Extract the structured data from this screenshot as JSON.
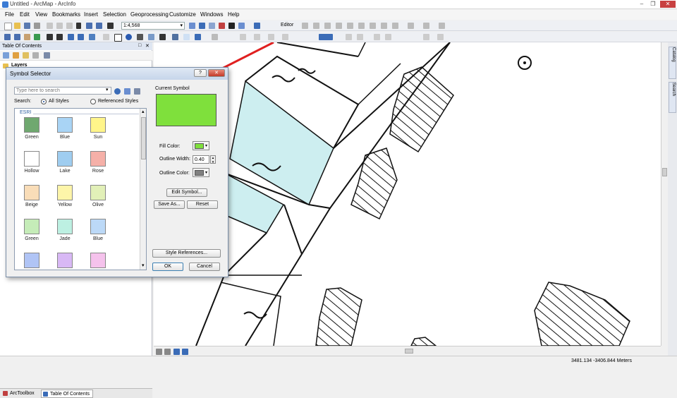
{
  "window": {
    "title": "Untitled - ArcMap - ArcInfo"
  },
  "menu": [
    "File",
    "Edit",
    "View",
    "Bookmarks",
    "Insert",
    "Selection",
    "Geoprocessing",
    "Customize",
    "Windows",
    "Help"
  ],
  "toolbar": {
    "scale": "1:4,568",
    "editor_label": "Editor"
  },
  "toc": {
    "title": "Table Of Contents",
    "layers_label": "Layers"
  },
  "bottom_tabs": [
    "ArcToolbox",
    "Table Of Contents"
  ],
  "right_dock": [
    "Catalog",
    "Search"
  ],
  "status": {
    "coordinates": "3481.134  -3406.844 Meters"
  },
  "dialog": {
    "title": "Symbol Selector",
    "search_placeholder": "Type here to search",
    "search_label": "Search:",
    "all_styles": "All Styles",
    "referenced_styles": "Referenced Styles",
    "group": "ESRI",
    "current_symbol_label": "Current Symbol",
    "current_symbol_color": "#7fe03c",
    "fill_color_label": "Fill Color:",
    "fill_color": "#7fe03c",
    "outline_width_label": "Outline Width:",
    "outline_width": "0.40",
    "outline_color_label": "Outline Color:",
    "outline_color": "#808080",
    "edit_symbol": "Edit Symbol...",
    "save_as": "Save As...",
    "reset": "Reset",
    "style_references": "Style References...",
    "ok": "OK",
    "cancel": "Cancel",
    "swatches": [
      {
        "name": "Green",
        "color": "#6fa86f"
      },
      {
        "name": "Blue",
        "color": "#a9d4f5"
      },
      {
        "name": "Sun",
        "color": "#fff58a"
      },
      {
        "name": "Hollow",
        "color": "#ffffff"
      },
      {
        "name": "Lake",
        "color": "#9fcdf0"
      },
      {
        "name": "Rose",
        "color": "#f5b0a8"
      },
      {
        "name": "Beige",
        "color": "#f9ddb8"
      },
      {
        "name": "Yellow",
        "color": "#fdf5a9"
      },
      {
        "name": "Olive",
        "color": "#e2f0b8"
      },
      {
        "name": "Green",
        "color": "#c5ecb8"
      },
      {
        "name": "Jade",
        "color": "#bdf0e2"
      },
      {
        "name": "Blue",
        "color": "#bcd9f7"
      },
      {
        "name": "",
        "color": "#b0c4f5"
      },
      {
        "name": "",
        "color": "#d8b8f5"
      },
      {
        "name": "",
        "color": "#f5c2ec"
      }
    ]
  }
}
